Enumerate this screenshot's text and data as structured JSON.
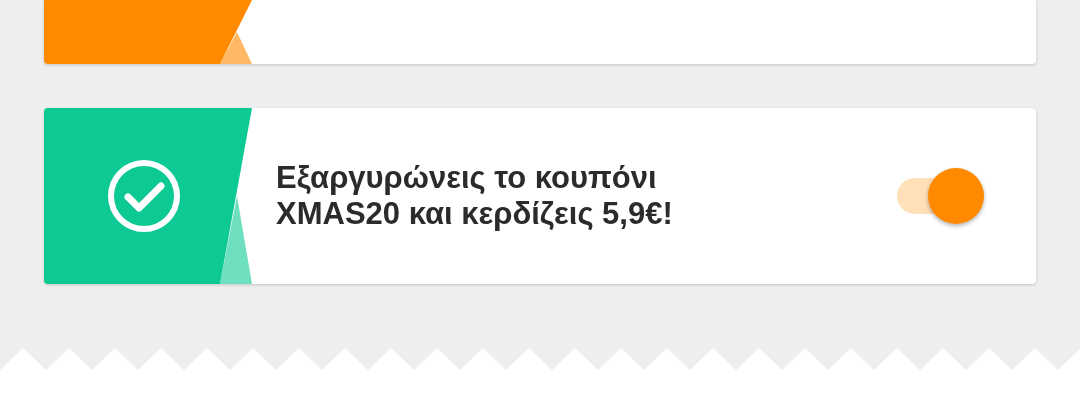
{
  "cards": [
    {
      "kind": "cut",
      "color": "#ff8a00"
    },
    {
      "kind": "coupon",
      "color": "#0dc994",
      "message": "Εξαργυρώνεις το κουπόνι XMAS20 και κερδίζεις 5,9€!",
      "on": true
    }
  ]
}
